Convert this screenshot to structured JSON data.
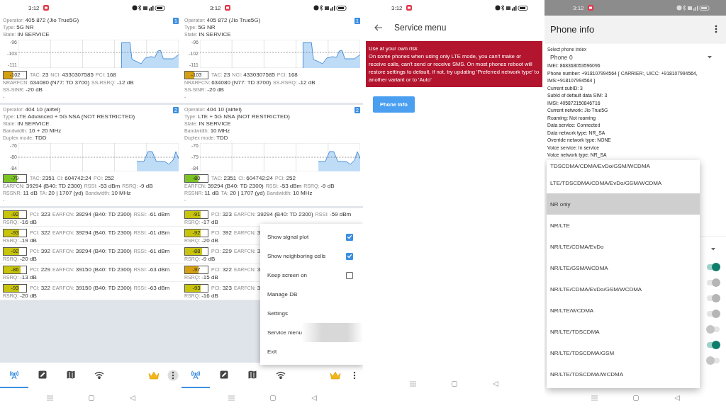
{
  "screens": [
    {
      "kind": "monitor",
      "status_bar": {
        "time": "3:12",
        "dimmed": false
      },
      "cells": [
        {
          "badge": "1",
          "info": [
            [
              {
                "label": "Operator:",
                "value": "405 872 (Jio True5G)"
              }
            ],
            [
              {
                "label": "Type:",
                "value": "5G NR"
              }
            ],
            [
              {
                "label": "State:",
                "value": "IN SERVICE"
              }
            ]
          ],
          "plot_ticks": [
            "-96",
            "-103",
            "-111"
          ],
          "signal": {
            "reading": "-102",
            "level": 0.4,
            "color": "#d4a012",
            "fields": [
              {
                "label": "TAC:",
                "value": "23"
              },
              {
                "label": "NCI:",
                "value": "4330307585"
              },
              {
                "label": "PCI:",
                "value": "168"
              }
            ]
          },
          "details": [
            [
              {
                "label": "NRARFCN:",
                "value": "634080 (N77: TD 3700)"
              },
              {
                "label": "SS-RSRQ:",
                "value": "-12 dB"
              }
            ],
            [
              {
                "label": "SS-SINR:",
                "value": "-20 dB"
              }
            ]
          ],
          "trailer": "-"
        },
        {
          "badge": "2",
          "info": [
            [
              {
                "label": "Operator:",
                "value": "404 10 (airtel)"
              }
            ],
            [
              {
                "label": "Type:",
                "value": "LTE Advanced + 5G NSA (NOT RESTRICTED)"
              }
            ],
            [
              {
                "label": "State:",
                "value": "IN SERVICE"
              }
            ],
            [
              {
                "label": "Bandwidth:",
                "value": "10 + 20 MHz"
              }
            ],
            [
              {
                "label": "Duplex mode:",
                "value": "TDD"
              }
            ]
          ],
          "plot_ticks": [
            "-76",
            "-80",
            "-84"
          ],
          "signal": {
            "reading": "-79",
            "level": 0.6,
            "color": "#7cc424",
            "fields": [
              {
                "label": "TAC:",
                "value": "2351"
              },
              {
                "label": "CI:",
                "value": "604742:24"
              },
              {
                "label": "PCI:",
                "value": "252"
              }
            ]
          },
          "details": [
            [
              {
                "label": "EARFCN:",
                "value": "39294 (B40: TD 2300)"
              },
              {
                "label": "RSSI:",
                "value": "-53 dBm"
              },
              {
                "label": "RSRQ:",
                "value": "-9 dB"
              }
            ],
            [
              {
                "label": "RSSNR:",
                "value": "11 dB"
              },
              {
                "label": "TA:",
                "value": "20 | 1707 (yd)"
              },
              {
                "label": "Bandwidth:",
                "value": "10 MHz"
              }
            ]
          ],
          "trailer": "-"
        }
      ],
      "neighbors": [
        {
          "reading": "-92",
          "level": 0.7,
          "color": "#c8c40c",
          "fields": [
            {
              "label": "PCI:",
              "value": "323"
            },
            {
              "label": "EARFCN:",
              "value": "39294 (B40: TD 2300)"
            },
            {
              "label": "RSSI:",
              "value": "-61 dBm"
            }
          ],
          "rsrq": {
            "label": "RSRQ:",
            "value": "-16 dB"
          }
        },
        {
          "reading": "-93",
          "level": 0.7,
          "color": "#c8c40c",
          "fields": [
            {
              "label": "PCI:",
              "value": "322"
            },
            {
              "label": "EARFCN:",
              "value": "39294 (B40: TD 2300)"
            },
            {
              "label": "RSSI:",
              "value": "-61 dBm"
            }
          ],
          "rsrq": {
            "label": "RSRQ:",
            "value": "-19 dB"
          }
        },
        {
          "reading": "-92",
          "level": 0.7,
          "color": "#c8c40c",
          "fields": [
            {
              "label": "PCI:",
              "value": "392"
            },
            {
              "label": "EARFCN:",
              "value": "39294 (B40: TD 2300)"
            },
            {
              "label": "RSSI:",
              "value": "-61 dBm"
            }
          ],
          "rsrq": {
            "label": "RSRQ:",
            "value": "-20 dB"
          }
        },
        {
          "reading": "-86",
          "level": 0.75,
          "color": "#c8c40c",
          "fields": [
            {
              "label": "PCI:",
              "value": "229"
            },
            {
              "label": "EARFCN:",
              "value": "39150 (B40: TD 2300)"
            },
            {
              "label": "RSSI:",
              "value": "-63 dBm"
            }
          ],
          "rsrq": {
            "label": "RSRQ:",
            "value": "-13 dB"
          }
        },
        {
          "reading": "-93",
          "level": 0.7,
          "color": "#c8c40c",
          "fields": [
            {
              "label": "PCI:",
              "value": "322"
            },
            {
              "label": "EARFCN:",
              "value": "39150 (B40: TD 2300)"
            },
            {
              "label": "RSSI:",
              "value": "-63 dBm"
            }
          ],
          "rsrq": {
            "label": "RSRQ:",
            "value": "-20 dB"
          }
        }
      ],
      "tabs": [
        {
          "kind": "antenna",
          "selected": true
        },
        {
          "kind": "clipboard",
          "selected": false
        },
        {
          "kind": "map",
          "selected": false
        },
        {
          "kind": "wifi",
          "selected": false
        }
      ],
      "more_pressed": true
    },
    {
      "kind": "monitor",
      "status_bar": {
        "time": "3:12",
        "dimmed": false
      },
      "cells": [
        {
          "badge": "1",
          "info": [
            [
              {
                "label": "Operator:",
                "value": "405 872 (Jio True5G)"
              }
            ],
            [
              {
                "label": "Type:",
                "value": "5G NR"
              }
            ],
            [
              {
                "label": "State:",
                "value": "IN SERVICE"
              }
            ]
          ],
          "plot_ticks": [
            "-96",
            "-102",
            "-111"
          ],
          "signal": {
            "reading": "-103",
            "level": 0.4,
            "color": "#d4a012",
            "fields": [
              {
                "label": "TAC:",
                "value": "23"
              },
              {
                "label": "NCI:",
                "value": "4330307585"
              },
              {
                "label": "PCI:",
                "value": "168"
              }
            ]
          },
          "details": [
            [
              {
                "label": "NRARFCN:",
                "value": "634080 (N77: TD 3700)"
              },
              {
                "label": "SS-RSRQ:",
                "value": "-12 dB"
              }
            ],
            [
              {
                "label": "SS-SINR:",
                "value": "-20 dB"
              }
            ]
          ],
          "trailer": "-"
        },
        {
          "badge": "2",
          "info": [
            [
              {
                "label": "Operator:",
                "value": "404 10 (airtel)"
              }
            ],
            [
              {
                "label": "Type:",
                "value": "LTE + 5G NSA (NOT RESTRICTED)"
              }
            ],
            [
              {
                "label": "State:",
                "value": "IN SERVICE"
              }
            ],
            [
              {
                "label": "Bandwidth:",
                "value": "10 MHz"
              }
            ],
            [
              {
                "label": "Duplex mode:",
                "value": "TDD"
              }
            ]
          ],
          "plot_ticks": [
            "-76",
            "-79",
            "-84"
          ],
          "signal": {
            "reading": "-80",
            "level": 0.6,
            "color": "#7cc424",
            "fields": [
              {
                "label": "TAC:",
                "value": "2351"
              },
              {
                "label": "CI:",
                "value": "604742:24"
              },
              {
                "label": "PCI:",
                "value": "252"
              }
            ]
          },
          "details": [
            [
              {
                "label": "EARFCN:",
                "value": "39294 (B40: TD 2300)"
              },
              {
                "label": "RSSI:",
                "value": "-53 dBm"
              },
              {
                "label": "RSRQ:",
                "value": "-9 dB"
              }
            ],
            [
              {
                "label": "RSSNR:",
                "value": "11 dB"
              },
              {
                "label": "TA:",
                "value": "20 | 1707 (yd)"
              },
              {
                "label": "Bandwidth:",
                "value": "10 MHz"
              }
            ]
          ],
          "trailer": "-"
        }
      ],
      "neighbors": [
        {
          "reading": "-91",
          "level": 0.7,
          "color": "#c8c40c",
          "fields": [
            {
              "label": "PCI:",
              "value": "323"
            },
            {
              "label": "EARFCN:",
              "value": "39294 (B40: TD 2300)"
            },
            {
              "label": "RSSI:",
              "value": "-59 dBm"
            }
          ],
          "rsrq": {
            "label": "RSRQ:",
            "value": "-17 dB"
          }
        },
        {
          "reading": "-92",
          "level": 0.7,
          "color": "#c8c40c",
          "fields": [
            {
              "label": "PCI:",
              "value": "392"
            },
            {
              "label": "EARFCN:",
              "value": "3"
            }
          ],
          "rsrq": {
            "label": "RSRQ:",
            "value": "-20 dB"
          }
        },
        {
          "reading": "-88",
          "level": 0.75,
          "color": "#c8c40c",
          "fields": [
            {
              "label": "PCI:",
              "value": "229"
            },
            {
              "label": "EARFCN:",
              "value": "3"
            }
          ],
          "rsrq": {
            "label": "RSRQ:",
            "value": "-9 dB"
          }
        },
        {
          "reading": "-97",
          "level": 0.6,
          "color": "#d4a012",
          "fields": [
            {
              "label": "PCI:",
              "value": "322"
            },
            {
              "label": "EARFCN:",
              "value": "3"
            }
          ],
          "rsrq": {
            "label": "RSRQ:",
            "value": "-15 dB"
          }
        },
        {
          "reading": "-93",
          "level": 0.7,
          "color": "#c8c40c",
          "fields": [
            {
              "label": "PCI:",
              "value": "323"
            },
            {
              "label": "EARFCN:",
              "value": "3"
            }
          ],
          "rsrq": {
            "label": "RSRQ:",
            "value": "-16 dB"
          }
        }
      ],
      "tabs": [
        {
          "kind": "antenna",
          "selected": true
        },
        {
          "kind": "clipboard",
          "selected": false
        },
        {
          "kind": "map",
          "selected": false
        },
        {
          "kind": "wifi",
          "selected": false
        }
      ],
      "more_pressed": false,
      "menu": [
        {
          "label": "Show signal plot",
          "kind": "checkbox",
          "checked": true,
          "pressed": false
        },
        {
          "label": "Show neighboring cells",
          "kind": "checkbox",
          "checked": true,
          "pressed": false
        },
        {
          "label": "Keep screen on",
          "kind": "checkbox",
          "checked": false,
          "pressed": false
        },
        {
          "label": "Manage DB",
          "kind": "plain",
          "pressed": false
        },
        {
          "label": "Settings",
          "kind": "plain",
          "pressed": false
        },
        {
          "label": "Service menu",
          "kind": "plain",
          "pressed": true
        },
        {
          "label": "Exit",
          "kind": "plain",
          "pressed": false
        }
      ]
    },
    {
      "kind": "service_menu",
      "status_bar": {
        "time": "3:12",
        "dimmed": false
      },
      "title": "Service menu",
      "warning": {
        "title": "Use at your own risk",
        "text": "On some phones when using only LTE mode, you can't make or receive calls, can't send or receive SMS. On most phones reboot will restore settings to default, if not, try updating 'Preferred network type' to another variant or to 'Auto'"
      },
      "button": "Phone info"
    },
    {
      "kind": "phone_info",
      "status_bar": {
        "time": "3:12",
        "dimmed": true
      },
      "title": "Phone info",
      "phone_index": {
        "label": "Select phone index",
        "value": "Phone 0"
      },
      "info": [
        "IMEI: 868368053596096",
        "Phone number: +918107994564 { CARRIER:, UICC: +918107994564, IMS:+918107994564 }",
        "Current subID: 3",
        "SubId of default data SIM: 3",
        "IMSI: 405872150846716",
        "Current network: Jio True5G",
        "Roaming: Not roaming",
        "Data service: Connected",
        "Data network type: NR_SA",
        "Override network type: NONE",
        "Voice service: In service",
        "Voice network type: NR_SA"
      ],
      "network_options": [
        {
          "label": "TDSCDMA/CDMA/EvDo/GSM/WCDMA",
          "selected": false
        },
        {
          "label": "LTE/TDSCDMA/CDMA/EvDo/GSM/WCDMA",
          "selected": false
        },
        {
          "label": "NR only",
          "selected": true
        },
        {
          "label": "NR/LTE",
          "selected": false
        },
        {
          "label": "NR/LTE/CDMA/EvDo",
          "selected": false
        },
        {
          "label": "NR/LTE/GSM/WCDMA",
          "selected": false
        },
        {
          "label": "NR/LTE/CDMA/EvDo/GSM/WCDMA",
          "selected": false
        },
        {
          "label": "NR/LTE/WCDMA",
          "selected": false
        },
        {
          "label": "NR/LTE/TDSCDMA",
          "selected": false
        },
        {
          "label": "NR/LTE/TDSCDMA/GSM",
          "selected": false
        },
        {
          "label": "NR/LTE/TDSCDMA/WCDMA",
          "selected": false
        }
      ],
      "background_toggles": [
        {
          "on": true,
          "disabled": false
        },
        {
          "on": true,
          "disabled": true
        },
        {
          "on": true,
          "disabled": true
        },
        {
          "on": true,
          "disabled": true
        },
        {
          "on": false,
          "disabled": false
        },
        {
          "on": true,
          "disabled": false
        },
        {
          "on": false,
          "disabled": false
        }
      ]
    }
  ]
}
